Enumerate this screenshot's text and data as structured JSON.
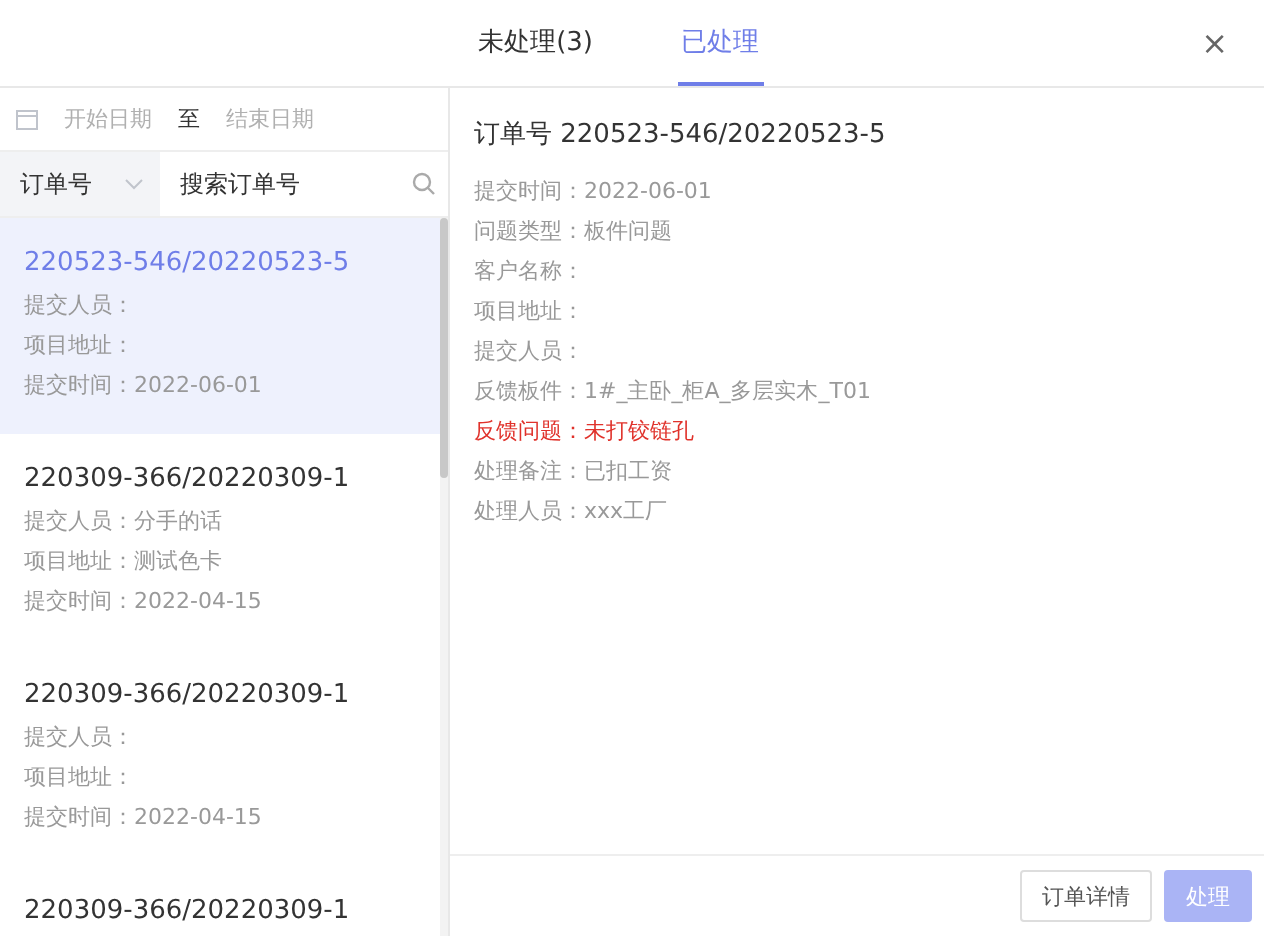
{
  "tabs": [
    {
      "label": "未处理(3)",
      "selected": false
    },
    {
      "label": "已处理",
      "selected": true
    }
  ],
  "close": "×",
  "date_range": {
    "start_placeholder": "开始日期",
    "separator": "至",
    "end_placeholder": "结束日期"
  },
  "search": {
    "filter": "订单号",
    "placeholder": "搜索订单号"
  },
  "orders": [
    {
      "title": "220523-546/20220523-5",
      "selected": true,
      "fields": [
        {
          "label": "提交人员："
        },
        {
          "label": "项目地址："
        },
        {
          "label": "提交时间：",
          "value": "2022-06-01"
        }
      ]
    },
    {
      "title": "220309-366/20220309-1",
      "selected": false,
      "fields": [
        {
          "label": "提交人员：",
          "value": "分手的话"
        },
        {
          "label": "项目地址：",
          "value": "测试色卡"
        },
        {
          "label": "提交时间：",
          "value": "2022-04-15"
        }
      ]
    },
    {
      "title": "220309-366/20220309-1",
      "selected": false,
      "fields": [
        {
          "label": "提交人员："
        },
        {
          "label": "项目地址："
        },
        {
          "label": "提交时间：",
          "value": "2022-04-15"
        }
      ]
    },
    {
      "title": "220309-366/20220309-1",
      "selected": false
    }
  ],
  "detail": {
    "title": "订单号 220523-546/20220523-5",
    "rows": [
      {
        "label": "提交时间：",
        "value": "2022-06-01",
        "alert": false
      },
      {
        "label": "问题类型：",
        "value": "板件问题",
        "alert": false
      },
      {
        "label": "客户名称：",
        "alert": false
      },
      {
        "label": "项目地址：",
        "alert": false
      },
      {
        "label": "提交人员：",
        "alert": false
      },
      {
        "label": "反馈板件：",
        "value": "1#_主卧_柜A_多层实木_T01",
        "alert": false
      },
      {
        "label": "反馈问题：",
        "value": "未打铰链孔",
        "alert": true
      },
      {
        "label": "处理备注：",
        "value": "已扣工资",
        "alert": false
      },
      {
        "label": "处理人员：",
        "value": "xxx工厂",
        "alert": false
      }
    ]
  },
  "buttons": [
    {
      "label": "订单详情",
      "kind": "secondary",
      "disabled": false
    },
    {
      "label": "处理",
      "kind": "primary",
      "disabled": true
    }
  ]
}
